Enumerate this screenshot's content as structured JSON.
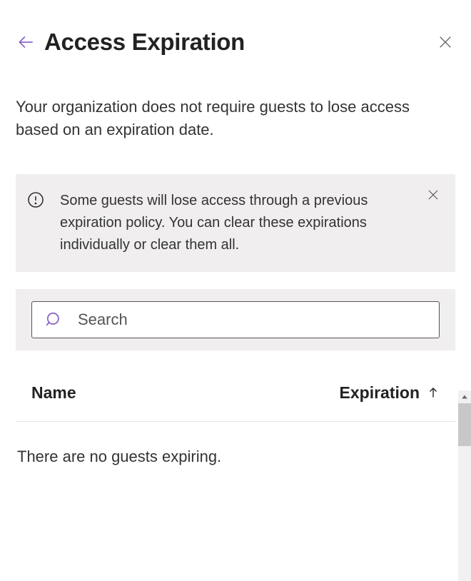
{
  "header": {
    "title": "Access Expiration"
  },
  "description": "Your organization does not require guests to lose access based on an expiration date.",
  "info_banner": {
    "message": "Some guests will lose access through a previous expiration policy. You can clear these expirations individually or clear them all."
  },
  "search": {
    "placeholder": "Search",
    "value": ""
  },
  "table": {
    "columns": {
      "name": "Name",
      "expiration": "Expiration"
    },
    "sort": {
      "column": "expiration",
      "direction": "asc"
    },
    "rows": []
  },
  "empty_message": "There are no guests expiring."
}
